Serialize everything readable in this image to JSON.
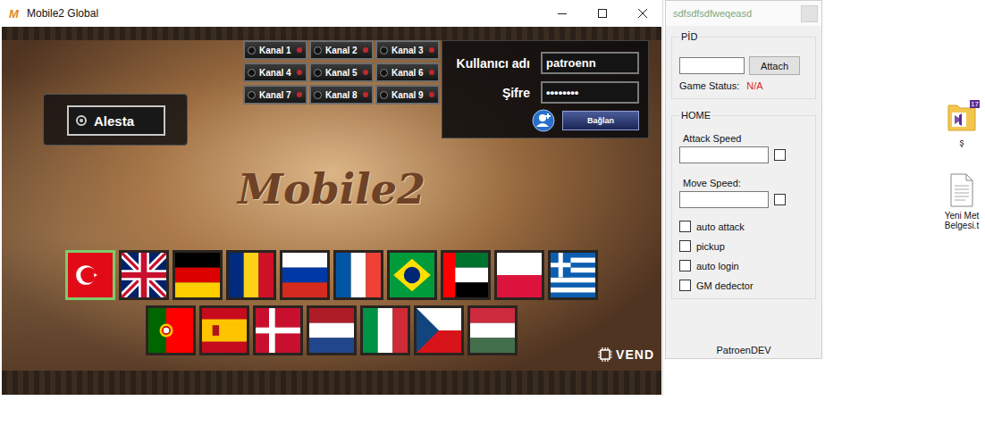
{
  "game_window": {
    "app_icon": "M",
    "title": "Mobile2 Global",
    "channels": [
      {
        "label": "Kanal 1",
        "selected": false
      },
      {
        "label": "Kanal 2",
        "selected": false
      },
      {
        "label": "Kanal 3",
        "selected": false
      },
      {
        "label": "Kanal 4",
        "selected": false
      },
      {
        "label": "Kanal 5",
        "selected": false
      },
      {
        "label": "Kanal 6",
        "selected": false
      },
      {
        "label": "Kanal 7",
        "selected": false
      },
      {
        "label": "Kanal 8",
        "selected": false
      },
      {
        "label": "Kanal 9",
        "selected": false
      }
    ],
    "server": {
      "label": "Alesta",
      "selected": true
    },
    "login": {
      "username_label": "Kullanıcı adı",
      "username": "patroenn",
      "password_label": "Şifre",
      "password": "••••••••",
      "button": "Bağlan"
    },
    "logo": "Mobile2",
    "brand": "VEND",
    "flags": [
      {
        "kind": "tr",
        "selected": true
      },
      {
        "kind": "gb",
        "selected": false
      },
      {
        "kind": "de",
        "selected": false
      },
      {
        "kind": "ro",
        "selected": false
      },
      {
        "kind": "ru",
        "selected": false
      },
      {
        "kind": "fr",
        "selected": false
      },
      {
        "kind": "br",
        "selected": false
      },
      {
        "kind": "ae",
        "selected": false
      },
      {
        "kind": "pl",
        "selected": false
      },
      {
        "kind": "gr",
        "selected": false
      },
      {
        "kind": "pt",
        "selected": false
      },
      {
        "kind": "es",
        "selected": false
      },
      {
        "kind": "dk",
        "selected": false
      },
      {
        "kind": "nl",
        "selected": false
      },
      {
        "kind": "it",
        "selected": false
      },
      {
        "kind": "cz",
        "selected": false
      },
      {
        "kind": "hu",
        "selected": false
      }
    ]
  },
  "trainer": {
    "title": "sdfsdfsdfweqeasd",
    "pid_group": {
      "label": "PİD",
      "pid": "",
      "button": "Attach",
      "status_label": "Game Status:",
      "status": "N/A"
    },
    "home_group": {
      "label": "HOME",
      "fields": [
        {
          "label": "Attack Speed",
          "value": "",
          "checked": false
        },
        {
          "label": "Move Speed:",
          "value": "",
          "checked": false
        }
      ],
      "options": [
        {
          "label": "auto attack",
          "checked": false
        },
        {
          "label": "pickup",
          "checked": false
        },
        {
          "label": "auto login",
          "checked": false
        },
        {
          "label": "GM dedector",
          "checked": false
        }
      ]
    },
    "footer": "PatroenDEV"
  },
  "desktop_icons": [
    {
      "kind": "folder",
      "badge": "17",
      "lines": [
        "ş"
      ]
    },
    {
      "kind": "document",
      "badge": "",
      "lines": [
        "Yeni Met",
        "Belgesi.t"
      ]
    }
  ]
}
